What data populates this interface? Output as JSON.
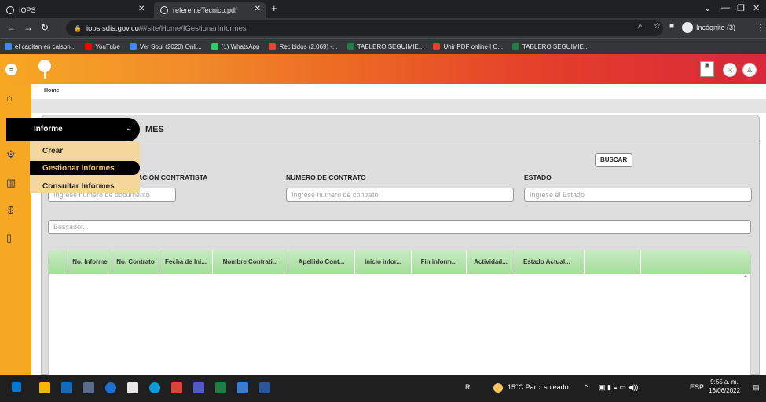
{
  "browser": {
    "tabs": [
      {
        "title": "IOPS"
      },
      {
        "title": "referenteTecnico.pdf"
      }
    ],
    "url_host": "iops.sdis.gov.co",
    "url_path": "/#/site/Home/IGestionarInformes",
    "incognito_label": "Incógnito (3)",
    "bookmarks": [
      {
        "label": "el capitan en calson...",
        "color": "#4285f4"
      },
      {
        "label": "YouTube",
        "color": "#ff0000"
      },
      {
        "label": "Ver Soul (2020) Onli...",
        "color": "#4285f4"
      },
      {
        "label": "(1) WhatsApp",
        "color": "#25d366"
      },
      {
        "label": "Recibidos (2.069) -...",
        "color": "#ea4335"
      },
      {
        "label": "TABLERO SEGUIMIE...",
        "color": "#1e7e45"
      },
      {
        "label": "Unir PDF online | C...",
        "color": "#e4402a"
      },
      {
        "label": "TABLERO SEGUIMIE...",
        "color": "#1e7e45"
      }
    ]
  },
  "breadcrumb": "Home",
  "menu": {
    "header": "Informe",
    "items": [
      "Crear",
      "Gestionar Informes",
      "Consultar Informes"
    ]
  },
  "panel": {
    "title_visible": "MES",
    "search_button": "BUSCAR",
    "filters": [
      {
        "label": "ACION CONTRATISTA",
        "placeholder": "Ingrese numero de documento"
      },
      {
        "label": "NUMERO DE CONTRATO",
        "placeholder": "Ingrese numero de contrato"
      },
      {
        "label": "ESTADO",
        "placeholder": "Ingrese el Estado"
      }
    ],
    "search_placeholder": "Buscador..."
  },
  "table": {
    "columns": [
      "No. Informe",
      "No. Contrato",
      "Fecha de Ini...",
      "Nombre Contrati...",
      "Apellido Cont...",
      "Inicio infor...",
      "Fin inform...",
      "Actividad...",
      "Estado Actual..."
    ]
  },
  "taskbar": {
    "weather": "15°C Parc. soleado",
    "lang": "ESP",
    "time": "9:55 a. m.",
    "date": "16/06/2022"
  },
  "colors": {
    "sidebar": "#f7a823",
    "header_start": "#f7a823",
    "header_end": "#d8283a",
    "table_header": "#b6e3ad",
    "menu_panel": "#f5d79e"
  }
}
